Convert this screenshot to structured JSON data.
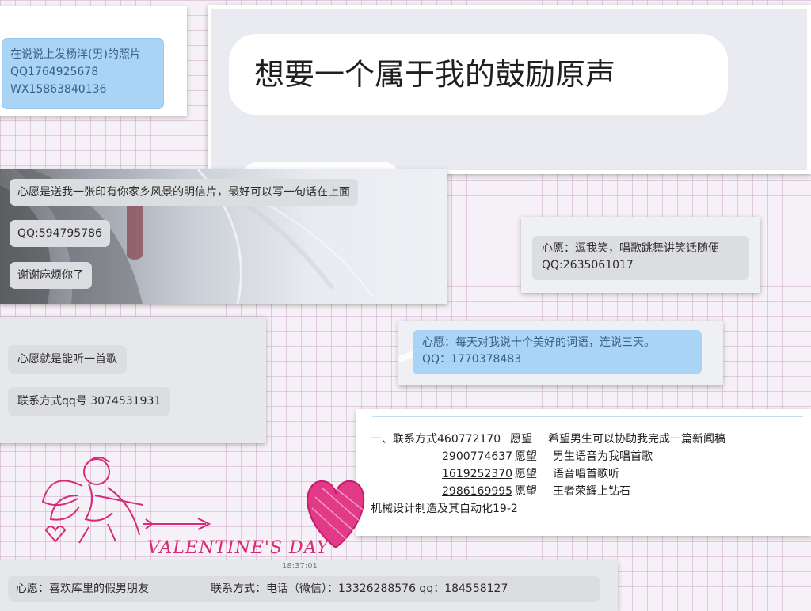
{
  "card1": {
    "lines": [
      "在说说上发杨洋(男)的照片",
      "QQ1764925678",
      "WX15863840136"
    ]
  },
  "card2": {
    "message": "想要一个属于我的鼓励原声"
  },
  "card3": {
    "messages": [
      "心愿是送我一张印有你家乡风景的明信片，最好可以写一句话在上面",
      "QQ:594795786",
      "谢谢麻烦你了"
    ]
  },
  "card4": {
    "lines": [
      "心愿：逗我笑，唱歌跳舞讲笑话随便",
      "QQ:2635061017"
    ]
  },
  "card5": {
    "messages": [
      "心愿就是能听一首歌",
      "联系方式qq号  3074531931"
    ]
  },
  "card6": {
    "lines": [
      "心愿：每天对我说十个美好的词语，连说三天。",
      "QQ：1770378483"
    ]
  },
  "card7": {
    "prefix": "一、联系方式",
    "wish_label": "愿望",
    "rows": [
      {
        "qq": "460772170",
        "wish": "希望男生可以协助我完成一篇新闻稿"
      },
      {
        "qq": "2900774637",
        "wish": "男生语音为我唱首歌"
      },
      {
        "qq": "1619252370",
        "wish": "语音唱首歌听"
      },
      {
        "qq": "2986169995",
        "wish": "王者荣耀上钻石"
      }
    ],
    "footer": "机械设计制造及其自动化19-2"
  },
  "card8": {
    "timestamp": "18:37:01",
    "wish": "心愿：喜欢库里的假男朋友",
    "contact": "联系方式：电话（微信）：13326288576   qq：184558127"
  },
  "decoration": {
    "banner_text": "VALENTINE'S DAY",
    "accent_color": "#d82a76"
  }
}
